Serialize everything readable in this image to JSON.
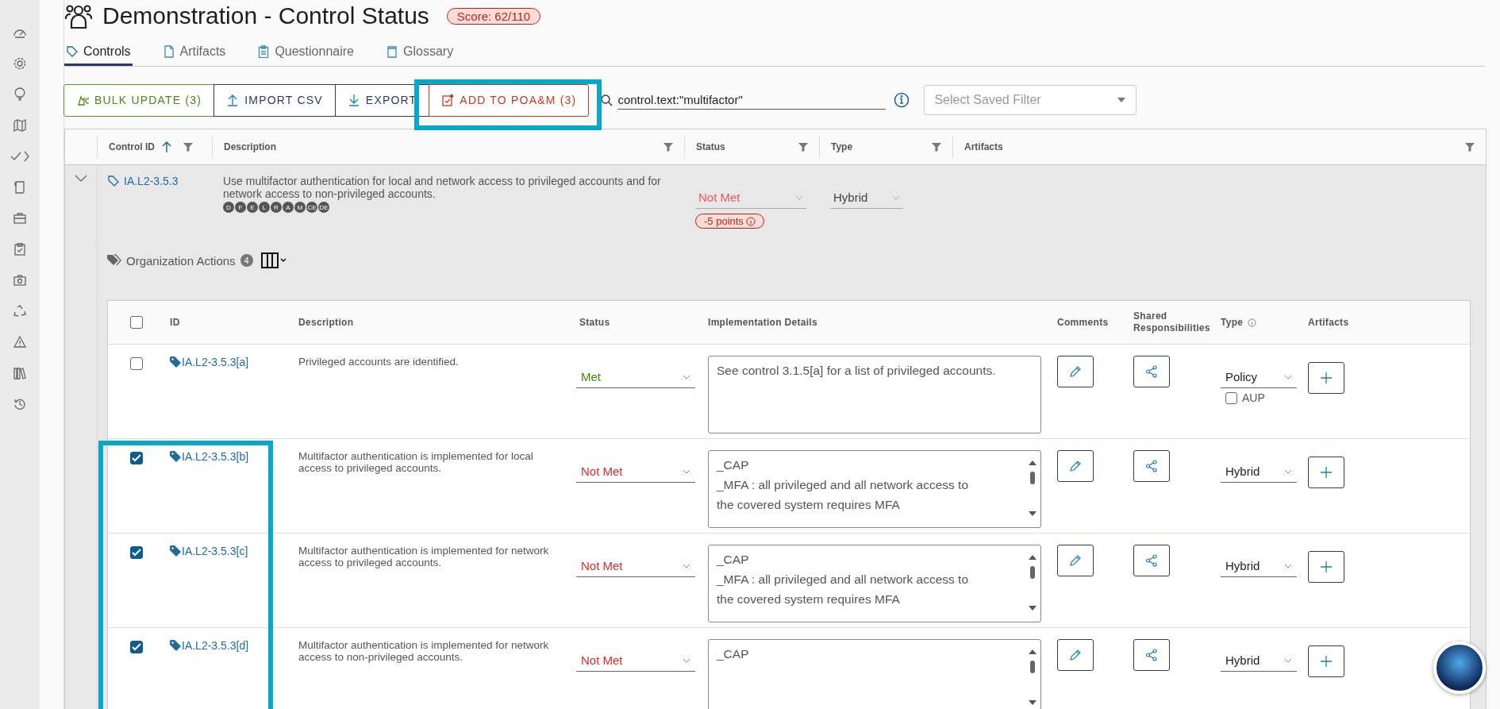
{
  "header": {
    "title": "Demonstration - Control Status",
    "score": "Score: 62/110"
  },
  "tabs": [
    {
      "label": "Controls",
      "selected": true,
      "kind": "tag"
    },
    {
      "label": "Artifacts",
      "selected": false,
      "kind": "document"
    },
    {
      "label": "Questionnaire",
      "selected": false,
      "kind": "clipboard"
    },
    {
      "label": "Glossary",
      "selected": false,
      "kind": "book"
    }
  ],
  "toolbar": {
    "buttons": [
      {
        "label": "BULK UPDATE (3)",
        "kind": "bulk"
      },
      {
        "label": "IMPORT CSV",
        "kind": "import"
      },
      {
        "label": "EXPORT",
        "kind": "export"
      },
      {
        "label": "ADD TO POA&M (3)",
        "kind": "poam"
      }
    ],
    "search": {
      "value": "control.text:\"multifactor\""
    },
    "saved_filter": {
      "placeholder": "Select Saved Filter"
    }
  },
  "table": {
    "columns": [
      "Control ID",
      "Description",
      "Status",
      "Type",
      "Artifacts"
    ],
    "control": {
      "expanded": true,
      "id": "IA.L2-3.5.3",
      "description": "Use multifactor authentication for local and network access to privileged accounts and for network access to non-privileged accounts.",
      "badges": [
        "D",
        "F",
        "E",
        "L",
        "R",
        "A",
        "M",
        "CE",
        "DE"
      ],
      "status": "Not Met",
      "color": "#e85a5a",
      "points": "-5 points",
      "type": "Hybrid"
    }
  },
  "org_actions": {
    "label": "Organization Actions",
    "count": "4",
    "select_all": {
      "checked": false
    },
    "columns": [
      "ID",
      "Description",
      "Status",
      "Implementation Details",
      "Comments",
      "Shared Responsibilities",
      "Type",
      "Artifacts"
    ],
    "rows": [
      {
        "checked": false,
        "id": "IA.L2-3.5.3[a]",
        "description": "Privileged accounts are identified.",
        "status": "Met",
        "color": "#3d8b00",
        "details": [
          "See control 3.1.5[a] for a list of privileged accounts."
        ],
        "scrollable": false,
        "type": "Policy",
        "aup": {
          "label": "AUP",
          "checked": false
        }
      },
      {
        "checked": true,
        "id": "IA.L2-3.5.3[b]",
        "description": "Multifactor authentication is implemented for local access to privileged accounts.",
        "status": "Not Met",
        "color": "#e02a2a",
        "details": [
          "_CAP",
          "_MFA : all privileged and all network access to",
          "the covered system requires MFA"
        ],
        "scrollable": true,
        "type": "Hybrid"
      },
      {
        "checked": true,
        "id": "IA.L2-3.5.3[c]",
        "description": "Multifactor authentication is implemented for network access to privileged accounts.",
        "status": "Not Met",
        "color": "#e02a2a",
        "details": [
          "_CAP",
          "_MFA : all privileged and all network access to",
          "the covered system requires MFA"
        ],
        "scrollable": true,
        "type": "Hybrid"
      },
      {
        "checked": true,
        "id": "IA.L2-3.5.3[d]",
        "description": "Multifactor authentication is implemented for network access to non-privileged accounts.",
        "status": "Not Met",
        "color": "#e02a2a",
        "details": [
          "_CAP"
        ],
        "scrollable": true,
        "type": "Hybrid"
      }
    ]
  }
}
